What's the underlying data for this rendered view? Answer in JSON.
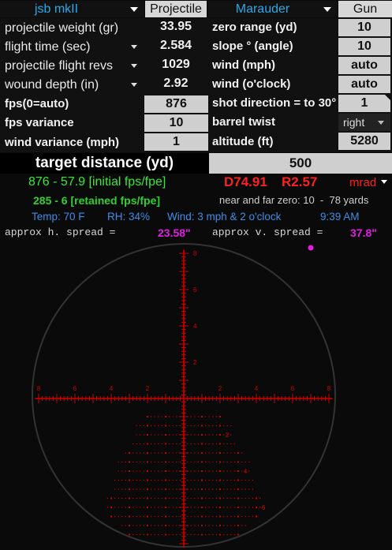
{
  "header": {
    "projectile_name": "jsb mkII",
    "projectile_tab": "Projectile",
    "gun_name": "Marauder",
    "gun_tab": "Gun"
  },
  "rows": {
    "projectile_weight": {
      "label": "projectile weight (gr)",
      "value": "33.95"
    },
    "flight_time": {
      "label": "flight time (sec)",
      "value": "2.584"
    },
    "flight_revs": {
      "label": "projectile flight revs",
      "value": "1029"
    },
    "wound_depth": {
      "label": "wound depth (in)",
      "value": "2.92"
    },
    "fps": {
      "label": "fps(0=auto)",
      "value": "876"
    },
    "fps_variance": {
      "label": "fps variance",
      "value": "10"
    },
    "wind_variance": {
      "label": "wind variance (mph)",
      "value": "1"
    }
  },
  "gun_rows": {
    "zero_range": {
      "label": "zero range (yd)",
      "value": "10"
    },
    "slope": {
      "label": "slope ° (angle)",
      "value": "10"
    },
    "wind_mph": {
      "label": "wind (mph)",
      "value": "auto"
    },
    "wind_clock": {
      "label": "wind (o'clock)",
      "value": "auto"
    },
    "shot_direction": {
      "label": "shot direction = to 30°",
      "value": "1"
    },
    "barrel_twist": {
      "label": "barrel twist",
      "value": "right"
    },
    "altitude": {
      "label": "altitude (ft)",
      "value": "5280"
    }
  },
  "target": {
    "label": "target distance (yd)",
    "value": "500"
  },
  "results": {
    "initial": "876 - 57.9 [initial fps/fpe]",
    "retained": "285 - 6 [retained fps/fpe]",
    "drop": "D74.91",
    "right": "R2.57",
    "unit": "mrad",
    "zeros": "near and far zero: 10  -  78 yards",
    "temp": "Temp: 70 F",
    "rh": "RH: 34%",
    "wind": "Wind: 3 mph & 2 o'clock",
    "time": "9:39 AM",
    "h_spread_label": "approx h. spread =",
    "h_spread_value": "23.58\"",
    "v_spread_label": "approx v. spread =",
    "v_spread_value": "37.8\""
  },
  "reticle": {
    "color": "#d00000",
    "upper_labels": [
      "8",
      "6",
      "4",
      "2"
    ],
    "horizontal_labels": [
      "8",
      "6",
      "4",
      "2",
      "2",
      "4",
      "6",
      "8"
    ],
    "lower_labels": [
      "2",
      "4",
      "6"
    ],
    "impact_color": "#e020e0"
  },
  "colors": {
    "header_blue": "#2aa8e8",
    "green": "#38e838",
    "green_dark": "#30d030",
    "red": "#ff2020",
    "info_blue": "#3c8ee8",
    "magenta": "#e020e0",
    "cell_bg": "#cfcfcf"
  }
}
